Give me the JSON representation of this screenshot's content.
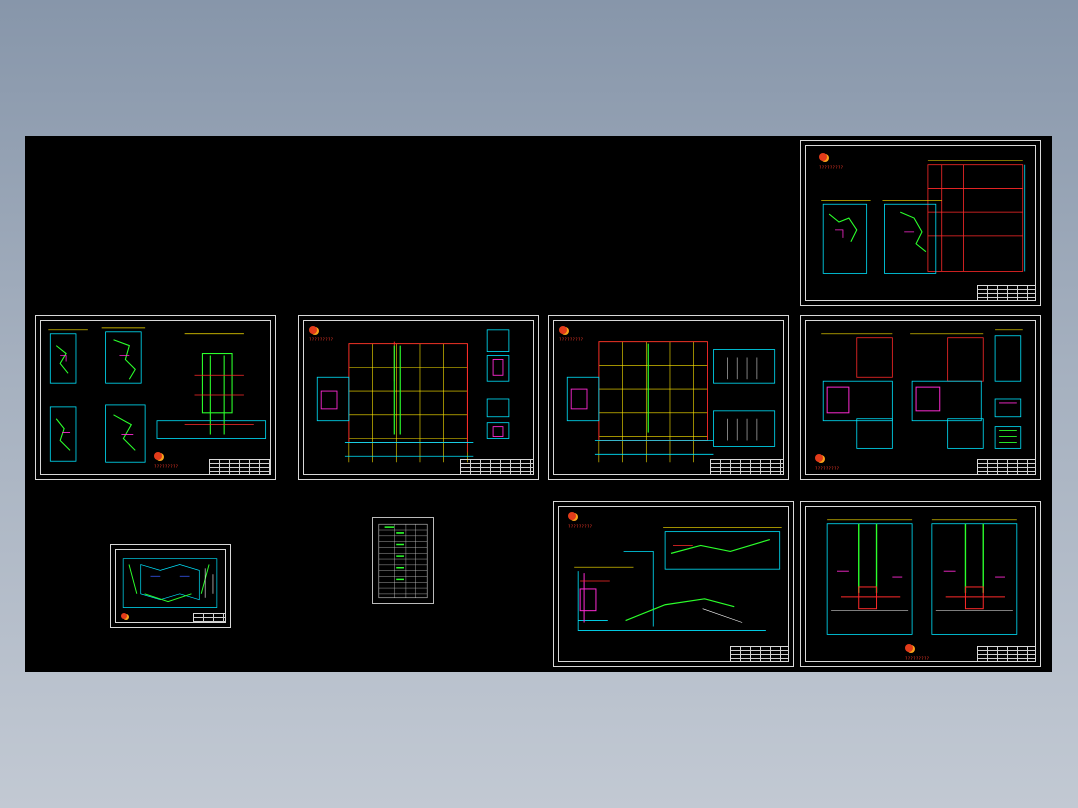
{
  "viewer": {
    "background_color": "#000000",
    "desktop_gradient": [
      "#8796aa",
      "#c2c9d3"
    ]
  },
  "colors": {
    "frame": "#d8d8d8",
    "cyan": "#00e5ff",
    "green": "#2bff2b",
    "red": "#ff2a2a",
    "magenta": "#ff2ad4",
    "yellow": "#ffe600",
    "white": "#ffffff",
    "blue": "#3a5bff"
  },
  "sheets": [
    {
      "id": "sheet-floor-plans-left",
      "kind": "drawing-sheet"
    },
    {
      "id": "sheet-plan-center-1",
      "kind": "drawing-sheet"
    },
    {
      "id": "sheet-plan-center-2",
      "kind": "drawing-sheet"
    },
    {
      "id": "sheet-top-right",
      "kind": "drawing-sheet"
    },
    {
      "id": "sheet-mid-right",
      "kind": "drawing-sheet"
    },
    {
      "id": "sheet-small-plan",
      "kind": "drawing-sheet"
    },
    {
      "id": "sheet-table",
      "kind": "drawing-sheet"
    },
    {
      "id": "sheet-section",
      "kind": "drawing-sheet"
    },
    {
      "id": "sheet-bottom-right",
      "kind": "drawing-sheet"
    }
  ],
  "logo_caption": "?????????"
}
